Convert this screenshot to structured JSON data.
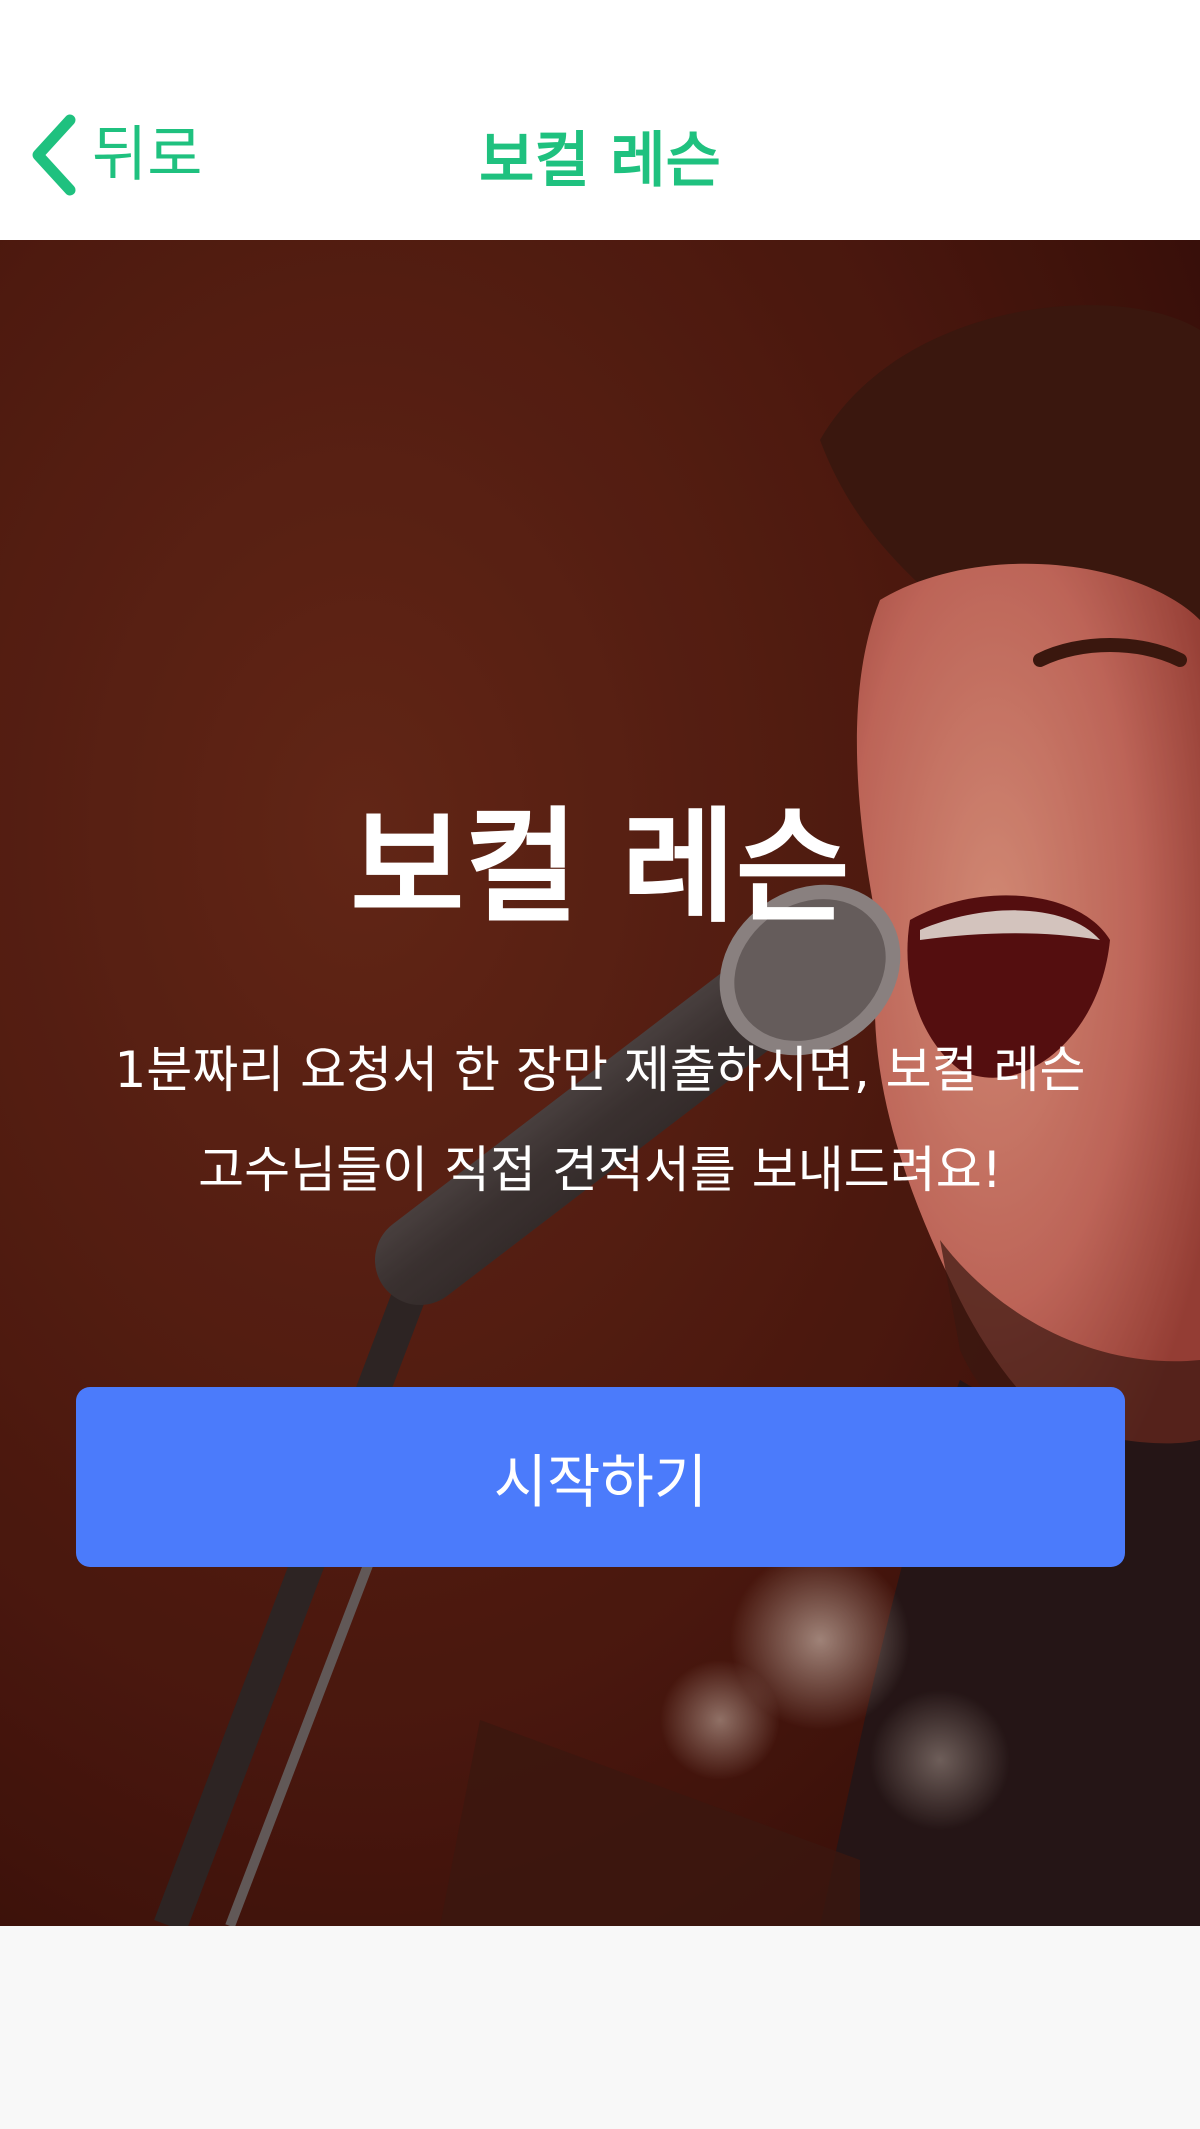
{
  "theme": {
    "accent": "#1fc17f",
    "primary": "#4b7bfb"
  },
  "header": {
    "back_icon": "chevron-left-icon",
    "back_label": "뒤로",
    "title": "보컬 레슨"
  },
  "hero": {
    "background_image": "singer-with-microphone-photo",
    "title": "보컬 레슨",
    "description": "1분짜리 요청서 한 장만 제출하시면, 보컬 레슨 고수님들이 직접 견적서를 보내드려요!",
    "start_label": "시작하기"
  },
  "lower_section": {
    "heading": ""
  }
}
